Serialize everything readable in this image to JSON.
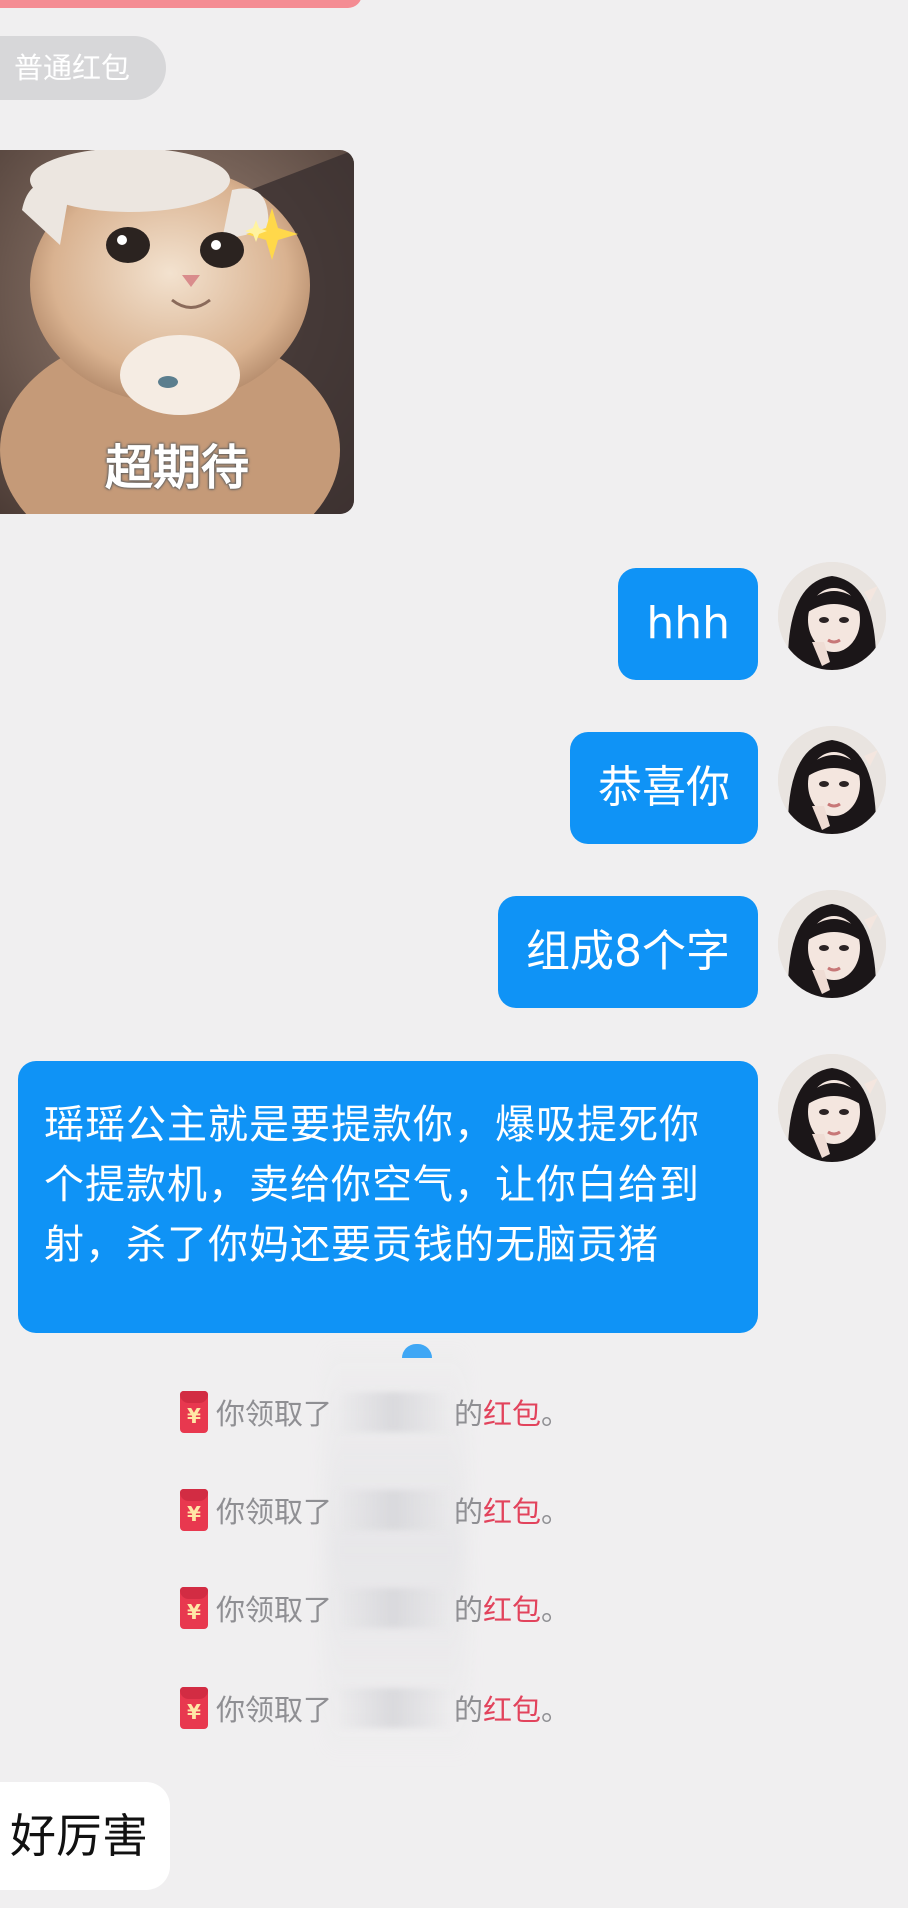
{
  "chat": {
    "tag_label": "普通红包",
    "sticker_caption": "超期待",
    "messages_out": [
      {
        "text": "hhh"
      },
      {
        "text": "恭喜你"
      },
      {
        "text": "组成8个字"
      },
      {
        "text": "瑶瑶公主就是要提款你，爆吸提死你个提款机，卖给你空气，让你白给到射，杀了你妈还要贡钱的无脑贡猪"
      }
    ],
    "system_notices": [
      {
        "prefix": "你领取了",
        "suffix": "的",
        "link": "红包",
        "end": "。"
      },
      {
        "prefix": "你领取了",
        "suffix": "的",
        "link": "红包",
        "end": "。"
      },
      {
        "prefix": "你领取了",
        "suffix": "的",
        "link": "红包",
        "end": "。"
      },
      {
        "prefix": "你领取了",
        "suffix": "的",
        "link": "红包",
        "end": "。"
      }
    ],
    "message_in": "好厉害",
    "colors": {
      "background": "#f0eff0",
      "bubble_blue": "#0f93f6",
      "red_packet": "#e8384f",
      "link_red": "#e2435c"
    },
    "icons": [
      "red-packet-icon",
      "avatar-image",
      "sticker-cat-image"
    ]
  }
}
